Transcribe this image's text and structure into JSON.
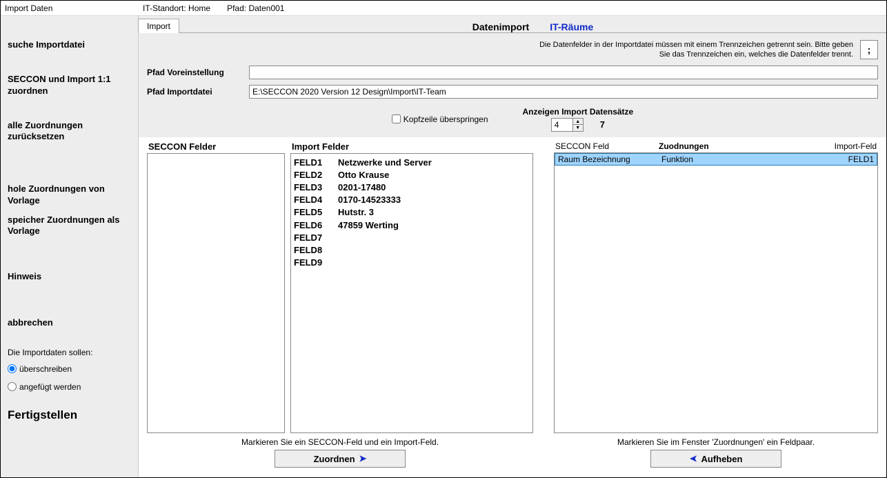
{
  "titlebar": {
    "title": "Import Daten",
    "standort_label": "IT-Standort:",
    "standort_value": "Home",
    "pfad_label": "Pfad:",
    "pfad_value": "Daten001"
  },
  "sidebar": {
    "items": [
      "suche Importdatei",
      "SECCON und Import 1:1 zuordnen",
      "alle Zuordnungen zurücksetzen",
      "hole Zuordnungen von Vorlage",
      "speicher Zuordnungen als Vorlage",
      "Hinweis",
      "abbrechen"
    ],
    "import_mode_label": "Die Importdaten sollen:",
    "radio_overwrite": "überschreiben",
    "radio_append": "angefügt werden",
    "finish": "Fertigstellen"
  },
  "tabs": {
    "active": "Import"
  },
  "breadcrumb": {
    "datenimport": "Datenimport",
    "itraeume": "IT-Räume"
  },
  "config": {
    "hint": "Die Datenfelder in der Importdatei müssen mit einem Trennzeichen getrennt sein. Bitte geben Sie das Trennzeichen ein, welches die Datenfelder trennt.",
    "delimiter": ";",
    "path_preset_label": "Pfad Voreinstellung",
    "path_preset_value": "",
    "path_import_label": "Pfad Importdatei",
    "path_import_value": "E:\\SECCON 2020 Version 12 Design\\Import\\IT-Team",
    "skip_header_label": "Kopfzeile überspringen",
    "skip_header_checked": false,
    "records_label": "Anzeigen Import Datensätze",
    "records_current": "4",
    "records_total": "7"
  },
  "seccon_fields_title": "SECCON Felder",
  "import_fields_title": "Import Felder",
  "import_fields": [
    {
      "id": "FELD1",
      "value": "Netzwerke und Server"
    },
    {
      "id": "FELD2",
      "value": "Otto Krause"
    },
    {
      "id": "FELD3",
      "value": "0201-17480"
    },
    {
      "id": "FELD4",
      "value": "0170-14523333"
    },
    {
      "id": "FELD5",
      "value": "Hutstr. 3"
    },
    {
      "id": "FELD6",
      "value": "47859 Werting"
    },
    {
      "id": "FELD7",
      "value": ""
    },
    {
      "id": "FELD8",
      "value": ""
    },
    {
      "id": "FELD9",
      "value": ""
    }
  ],
  "mapping": {
    "header_seccon": "SECCON Feld",
    "header_title": "Zuodnungen",
    "header_import": "Import-Feld",
    "rows": [
      {
        "seccon": "Raum Bezeichnung",
        "funktion": "Funktion",
        "import": "FELD1",
        "selected": true
      }
    ]
  },
  "hints": {
    "left": "Markieren Sie ein SECCON-Feld und ein Import-Feld.",
    "right": "Markieren Sie im Fenster 'Zuordnungen' ein Feldpaar."
  },
  "buttons": {
    "zuordnen": "Zuordnen",
    "aufheben": "Aufheben"
  }
}
